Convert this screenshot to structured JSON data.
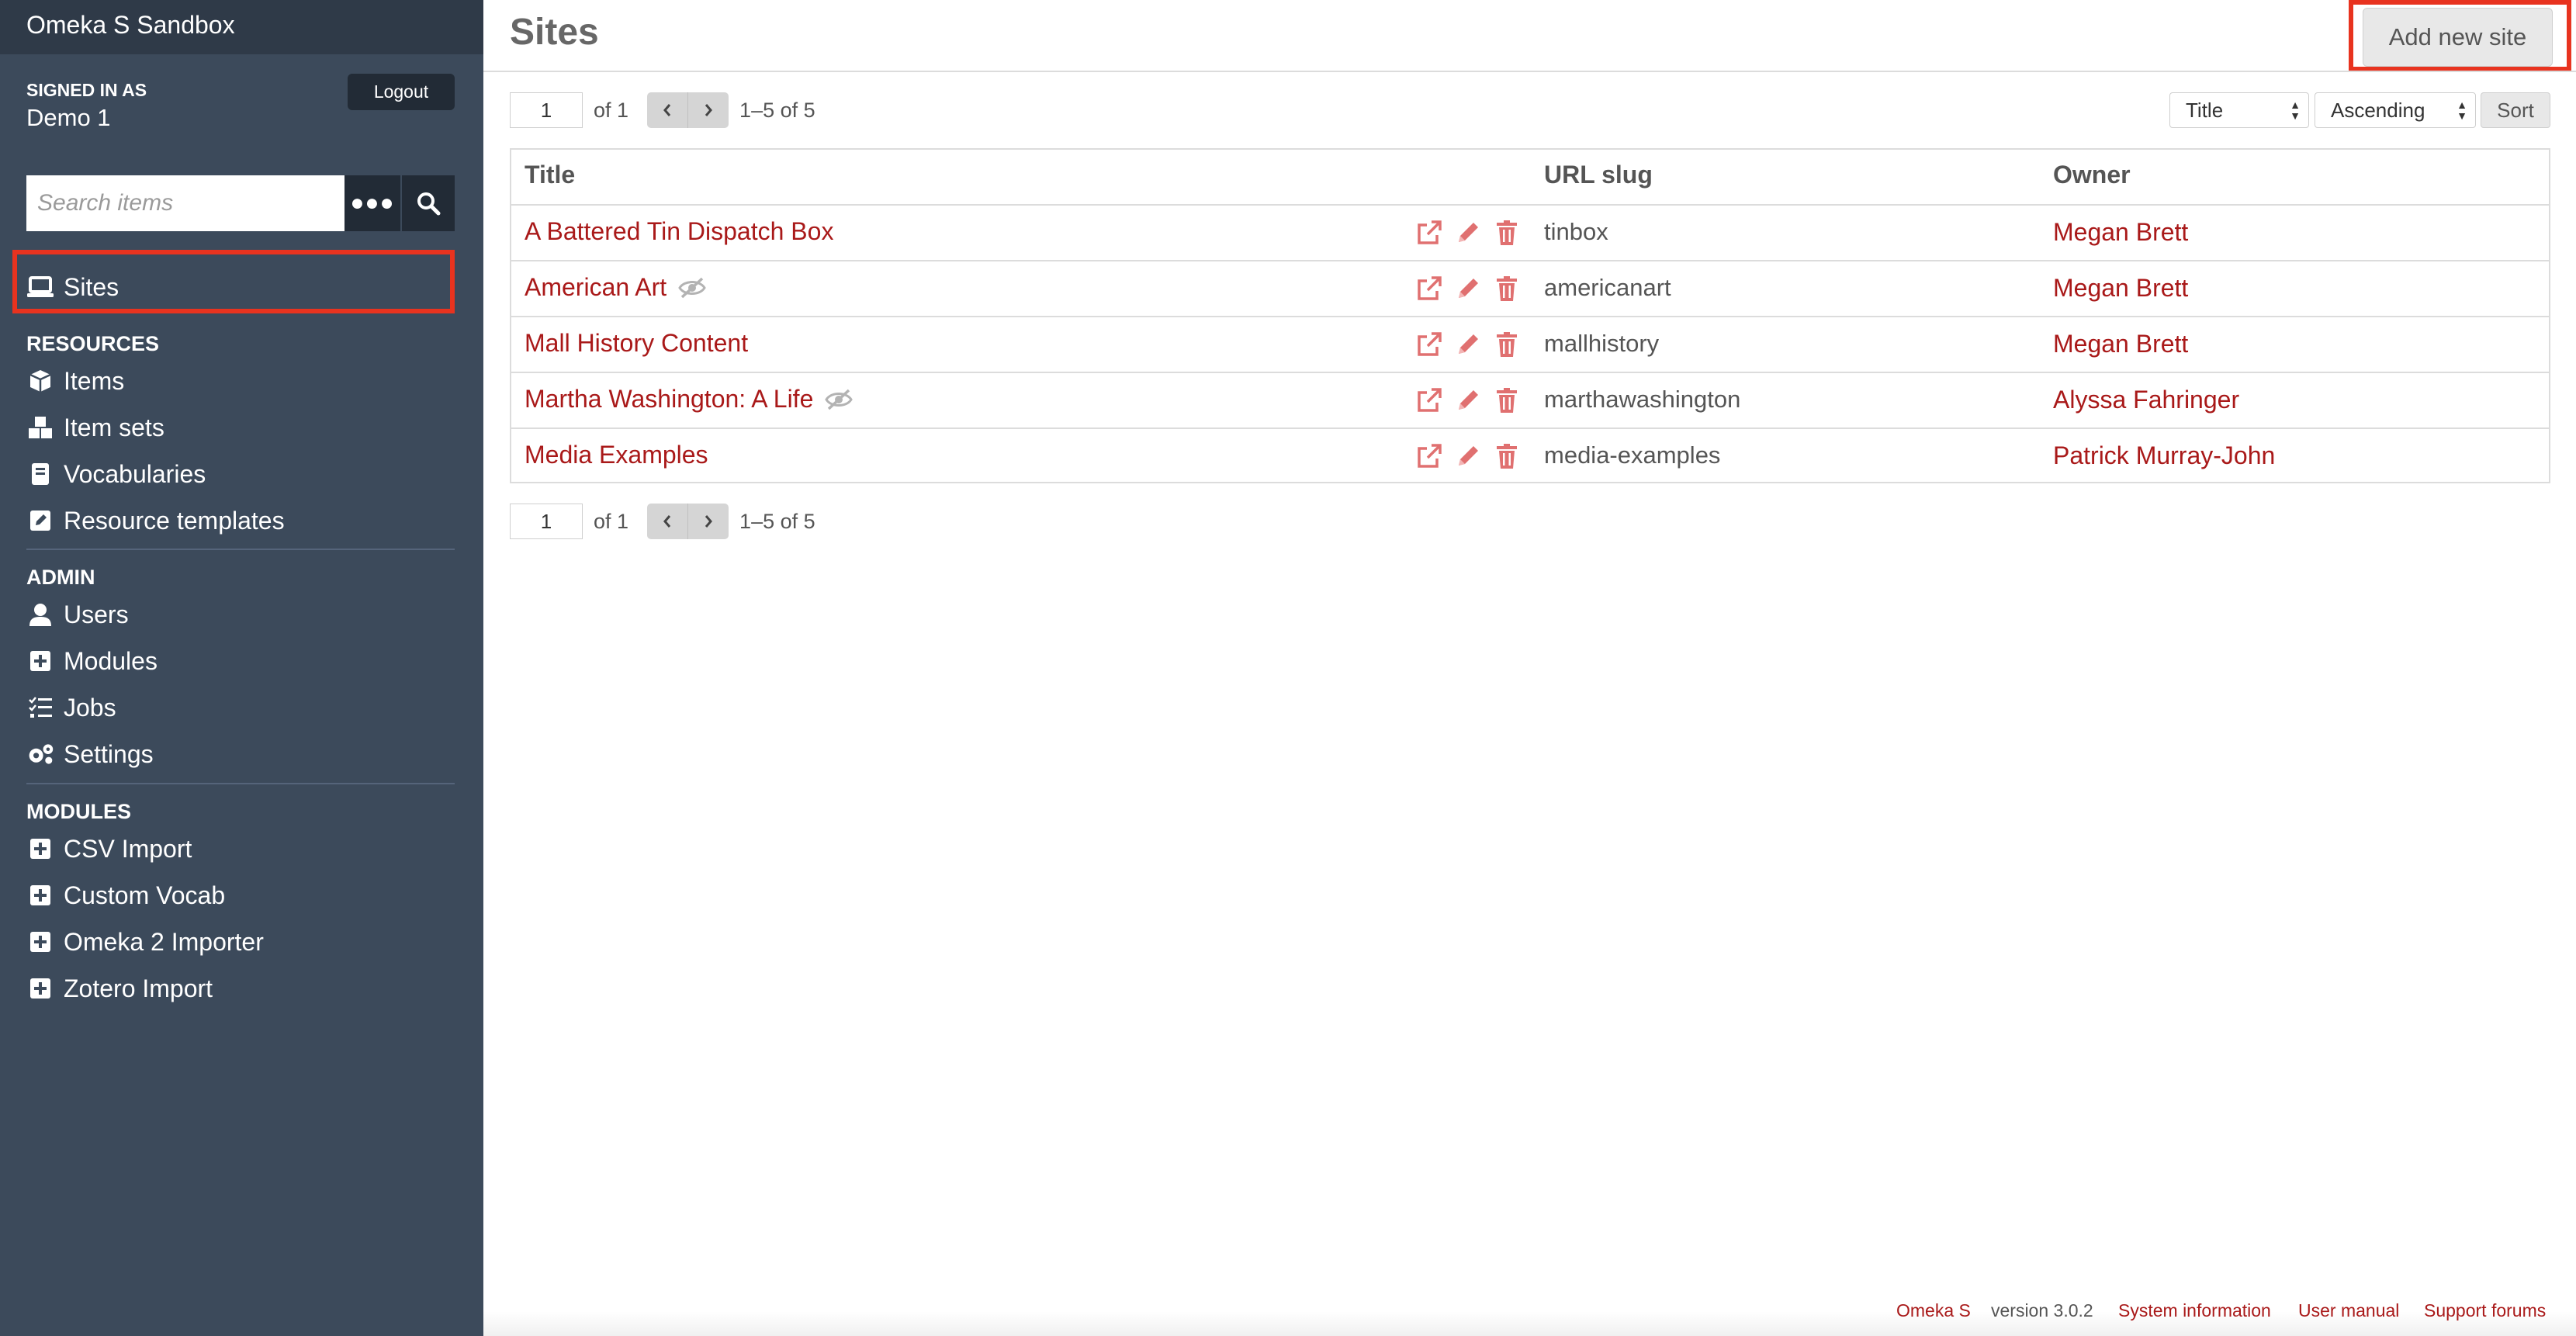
{
  "sidebar": {
    "install_title": "Omeka S Sandbox",
    "signed_in_label": "SIGNED IN AS",
    "user_name": "Demo 1",
    "logout_label": "Logout",
    "search": {
      "placeholder": "Search items",
      "advanced_icon": "ellipsis-icon",
      "submit_icon": "search-icon"
    },
    "sites": {
      "label": "Sites",
      "icon": "laptop-icon"
    },
    "resources_heading": "RESOURCES",
    "resources": [
      {
        "label": "Items",
        "icon": "cube-icon"
      },
      {
        "label": "Item sets",
        "icon": "cubes-icon"
      },
      {
        "label": "Vocabularies",
        "icon": "book-icon"
      },
      {
        "label": "Resource templates",
        "icon": "edit-square-icon"
      }
    ],
    "admin_heading": "ADMIN",
    "admin": [
      {
        "label": "Users",
        "icon": "user-icon"
      },
      {
        "label": "Modules",
        "icon": "plus-square-icon"
      },
      {
        "label": "Jobs",
        "icon": "tasks-icon"
      },
      {
        "label": "Settings",
        "icon": "cogs-icon"
      }
    ],
    "modules_heading": "MODULES",
    "modules": [
      {
        "label": "CSV Import",
        "icon": "plus-square-icon"
      },
      {
        "label": "Custom Vocab",
        "icon": "plus-square-icon"
      },
      {
        "label": "Omeka 2 Importer",
        "icon": "plus-square-icon"
      },
      {
        "label": "Zotero Import",
        "icon": "plus-square-icon"
      }
    ]
  },
  "main": {
    "title": "Sites",
    "add_button": "Add new site",
    "pagination": {
      "page": "1",
      "of_label": "of 1",
      "range": "1–5 of 5"
    },
    "sort": {
      "field": "Title",
      "order": "Ascending",
      "button": "Sort"
    },
    "table": {
      "columns": [
        "Title",
        "URL slug",
        "Owner"
      ],
      "rows": [
        {
          "title": "A Battered Tin Dispatch Box",
          "private": false,
          "slug": "tinbox",
          "owner": "Megan Brett"
        },
        {
          "title": "American Art",
          "private": true,
          "slug": "americanart",
          "owner": "Megan Brett"
        },
        {
          "title": "Mall History Content",
          "private": false,
          "slug": "mallhistory",
          "owner": "Megan Brett"
        },
        {
          "title": "Martha Washington: A Life",
          "private": true,
          "slug": "marthawashington",
          "owner": "Alyssa Fahringer"
        },
        {
          "title": "Media Examples",
          "private": false,
          "slug": "media-examples",
          "owner": "Patrick Murray-John"
        }
      ]
    }
  },
  "footer": {
    "brand": "Omeka S",
    "version": "version 3.0.2",
    "links": [
      "System information",
      "User manual",
      "Support forums"
    ]
  },
  "colors": {
    "sidebar": "#3c4a5b",
    "sidebar_dark": "#2f3a48",
    "link": "#a91919",
    "action_icon": "#e07070",
    "highlight": "#e8331f"
  }
}
